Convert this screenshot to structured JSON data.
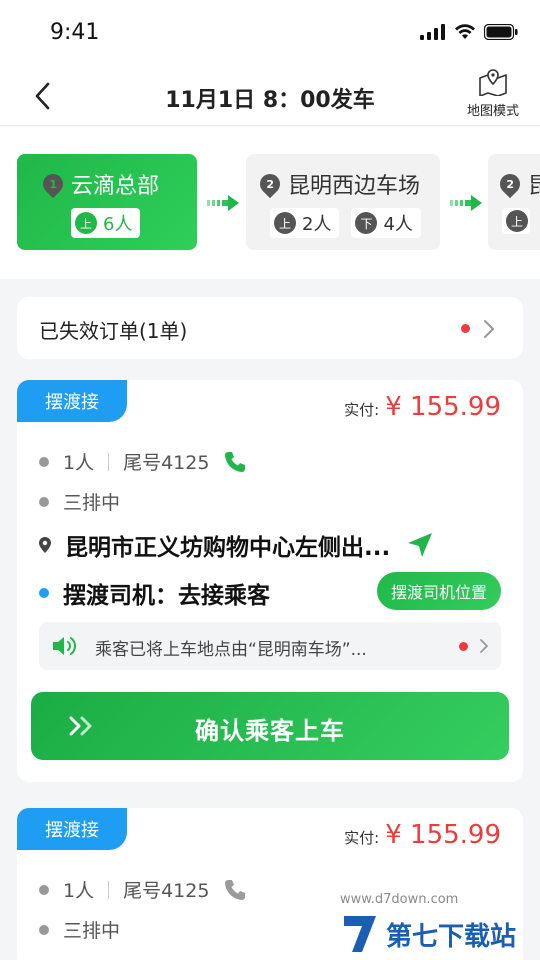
{
  "status": {
    "time": "9:41"
  },
  "nav": {
    "title": "11月1日 8：00发车",
    "map_mode": "地图模式"
  },
  "stops": [
    {
      "index": "1",
      "name": "云滴总部",
      "counts": [
        {
          "type": "上",
          "value": "6人"
        }
      ]
    },
    {
      "index": "2",
      "name": "昆明西边车场",
      "counts": [
        {
          "type": "上",
          "value": "2人"
        },
        {
          "type": "下",
          "value": "4人"
        }
      ]
    },
    {
      "index": "2",
      "name": "昆",
      "counts": [
        {
          "type": "上",
          "value": ""
        }
      ]
    }
  ],
  "expired": {
    "label": "已失效订单(1单)"
  },
  "orders": [
    {
      "tag": "摆渡接",
      "price_label": "实付:",
      "price": "¥ 155.99",
      "people": "1人",
      "phone_tail": "尾号4125",
      "seat": "三排中",
      "address": "昆明市正义坊购物中心左侧出...",
      "driver_status": "摆渡司机：去接乘客",
      "driver_pos_btn": "摆渡司机位置",
      "notice": "乘客已将上车地点由“昆明南车场”...",
      "confirm": "确认乘客上车"
    },
    {
      "tag": "摆渡接",
      "price_label": "实付:",
      "price": "¥ 155.99",
      "people": "1人",
      "phone_tail": "尾号4125",
      "seat": "三排中"
    }
  ],
  "watermark": {
    "text": "第七下载站",
    "sub": "www.d7down.com"
  },
  "colors": {
    "accent": "#1fb849",
    "tag_blue": "#1e9df2",
    "price_red": "#ee3b3b"
  }
}
